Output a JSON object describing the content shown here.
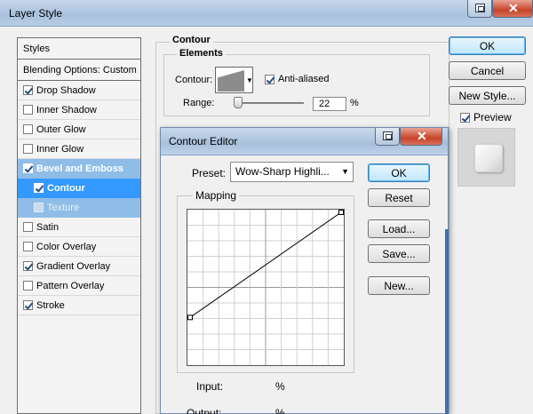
{
  "window": {
    "title": "Layer Style"
  },
  "styles_list": {
    "header": "Styles",
    "blending": "Blending Options: Custom",
    "items": [
      {
        "label": "Drop Shadow",
        "checked": true
      },
      {
        "label": "Inner Shadow",
        "checked": false
      },
      {
        "label": "Outer Glow",
        "checked": false
      },
      {
        "label": "Inner Glow",
        "checked": false
      },
      {
        "label": "Bevel and Emboss",
        "checked": true
      },
      {
        "label": "Contour",
        "checked": true
      },
      {
        "label": "Texture",
        "checked": false
      },
      {
        "label": "Satin",
        "checked": false
      },
      {
        "label": "Color Overlay",
        "checked": false
      },
      {
        "label": "Gradient Overlay",
        "checked": true
      },
      {
        "label": "Pattern Overlay",
        "checked": false
      },
      {
        "label": "Stroke",
        "checked": true
      }
    ]
  },
  "contour_panel": {
    "title": "Contour",
    "elements_title": "Elements",
    "contour_label": "Contour:",
    "anti_aliased_label": "Anti-aliased",
    "anti_aliased_checked": true,
    "range_label": "Range:",
    "range_value": "22",
    "range_unit": "%"
  },
  "right_buttons": {
    "ok": "OK",
    "cancel": "Cancel",
    "new_style": "New Style...",
    "preview_label": "Preview",
    "preview_checked": true
  },
  "contour_editor": {
    "title": "Contour Editor",
    "preset_label": "Preset:",
    "preset_value": "Wow-Sharp Highli...",
    "mapping_label": "Mapping",
    "input_label": "Input:",
    "input_unit": "%",
    "output_label": "Output:",
    "output_unit": "%",
    "buttons": {
      "ok": "OK",
      "reset": "Reset",
      "load": "Load...",
      "save": "Save...",
      "new": "New..."
    },
    "curve": {
      "start": [
        0,
        30
      ],
      "end": [
        100,
        100
      ]
    }
  }
}
